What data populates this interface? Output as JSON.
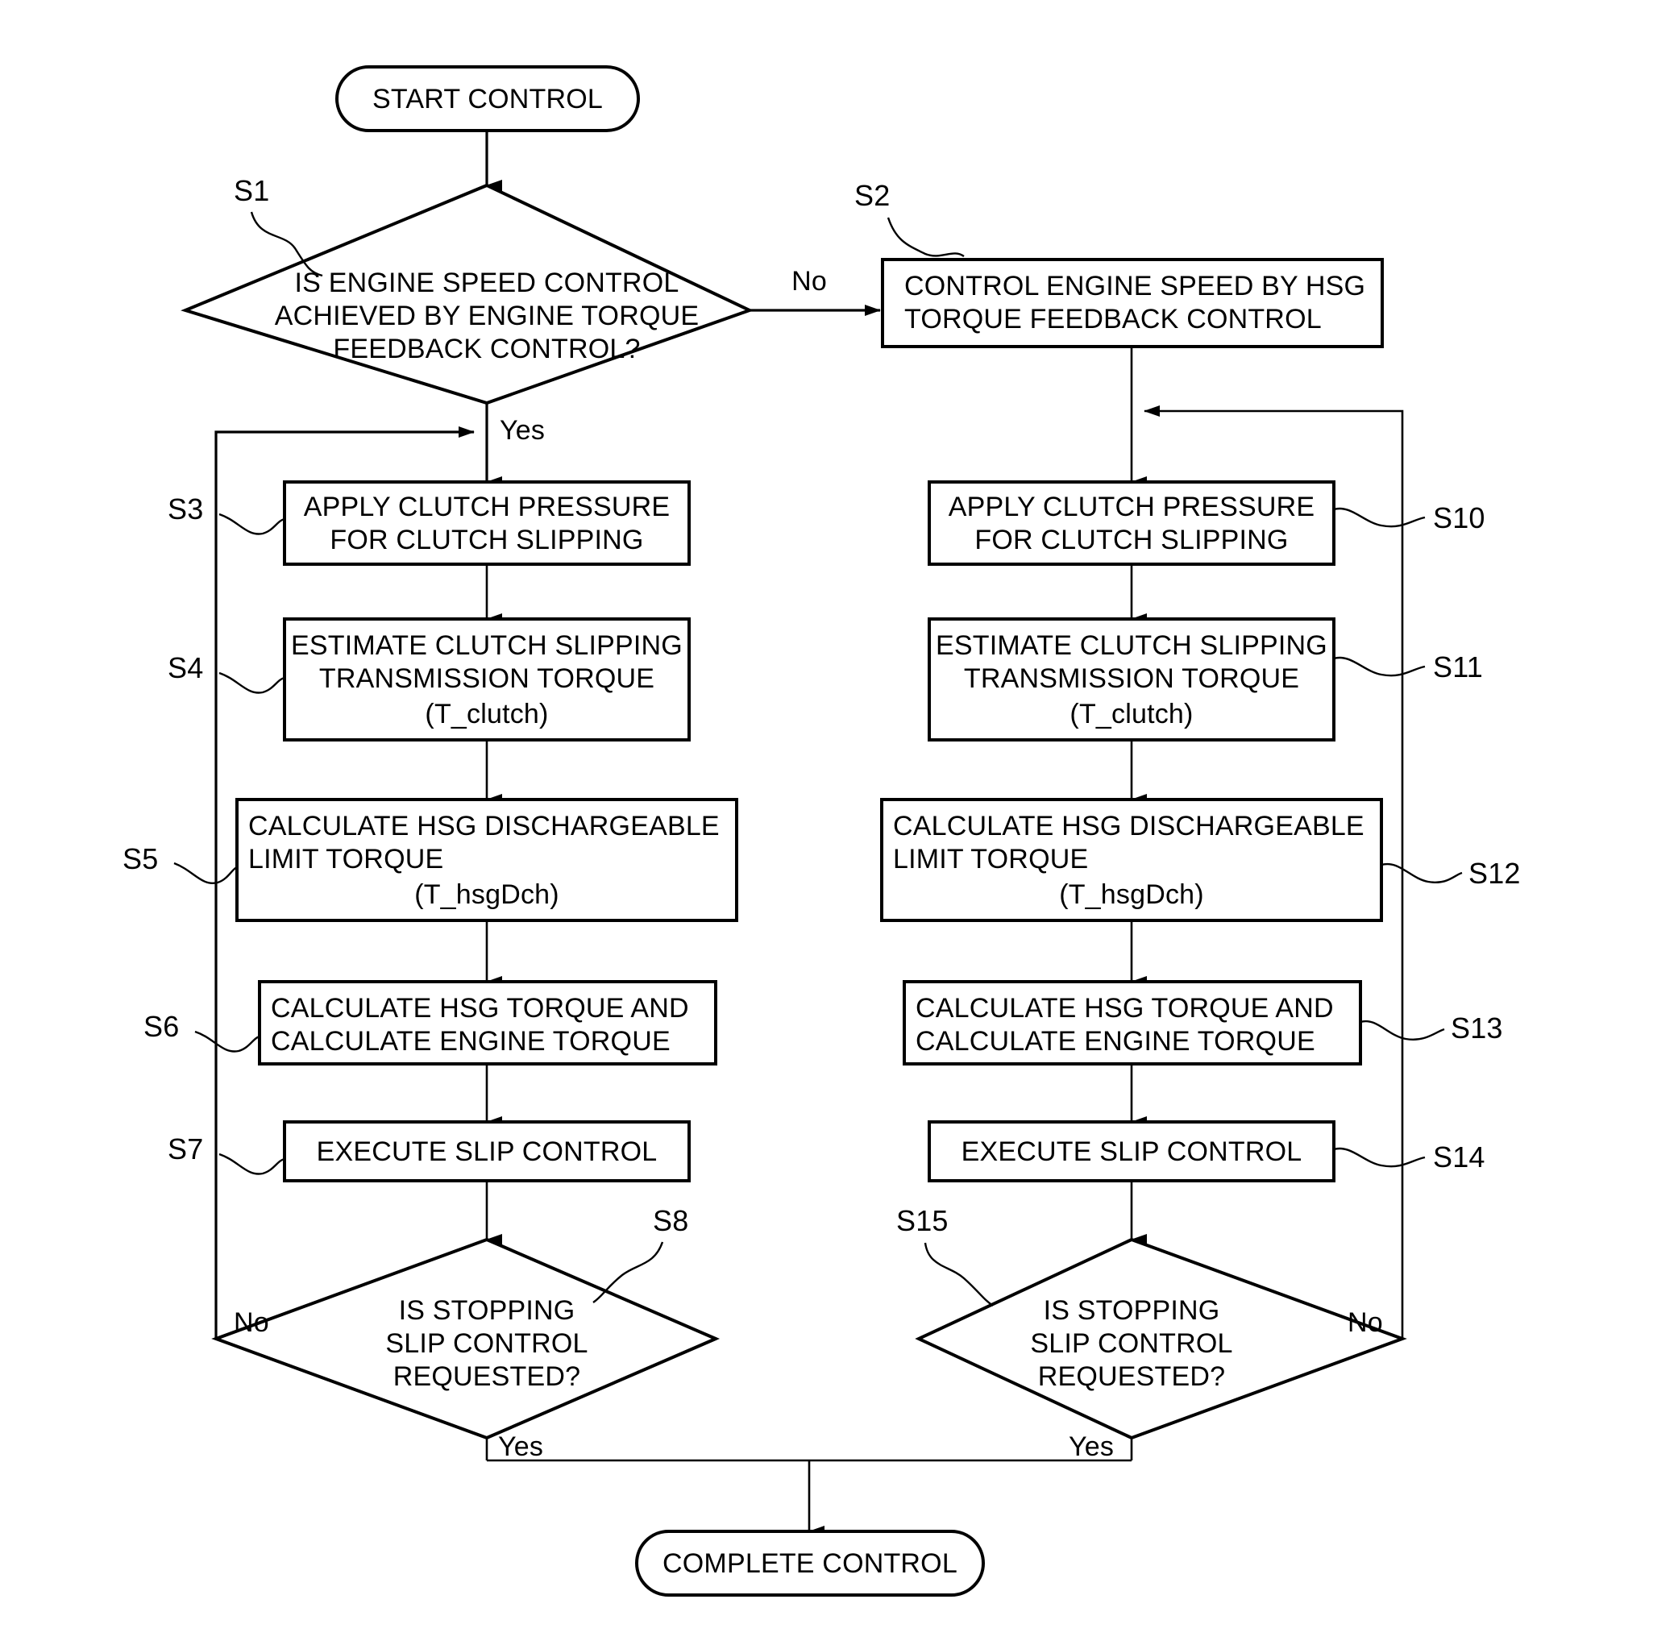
{
  "diagram": {
    "type": "flowchart",
    "title": "Engine speed and clutch slip control flowchart",
    "terminals": {
      "start": "START CONTROL",
      "end": "COMPLETE CONTROL"
    },
    "branch_labels": {
      "s1_no": "No",
      "s1_yes": "Yes",
      "s8_no": "No",
      "s8_yes": "Yes",
      "s15_no": "No",
      "s15_yes": "Yes"
    },
    "step_tags": {
      "s1": "S1",
      "s2": "S2",
      "s3": "S3",
      "s4": "S4",
      "s5": "S5",
      "s6": "S6",
      "s7": "S7",
      "s8": "S8",
      "s10": "S10",
      "s11": "S11",
      "s12": "S12",
      "s13": "S13",
      "s14": "S14",
      "s15": "S15"
    },
    "nodes": {
      "s1": {
        "kind": "decision",
        "lines": [
          "IS ENGINE SPEED CONTROL",
          "ACHIEVED BY ENGINE TORQUE",
          "FEEDBACK CONTROL?"
        ]
      },
      "s2": {
        "kind": "process",
        "lines": [
          "CONTROL ENGINE SPEED BY HSG",
          "TORQUE FEEDBACK CONTROL"
        ]
      },
      "s3": {
        "kind": "process",
        "lines": [
          "APPLY CLUTCH PRESSURE",
          "FOR CLUTCH SLIPPING"
        ]
      },
      "s4": {
        "kind": "process",
        "lines": [
          "ESTIMATE CLUTCH SLIPPING",
          "TRANSMISSION TORQUE",
          "(T_clutch)"
        ]
      },
      "s5": {
        "kind": "process",
        "lines": [
          "CALCULATE HSG DISCHARGEABLE",
          "LIMIT TORQUE",
          "(T_hsgDch)"
        ]
      },
      "s6": {
        "kind": "process",
        "lines": [
          "CALCULATE HSG TORQUE AND",
          "CALCULATE ENGINE TORQUE"
        ]
      },
      "s7": {
        "kind": "process",
        "lines": [
          "EXECUTE SLIP CONTROL"
        ]
      },
      "s8": {
        "kind": "decision",
        "lines": [
          "IS STOPPING",
          "SLIP CONTROL",
          "REQUESTED?"
        ]
      },
      "s10": {
        "kind": "process",
        "lines": [
          "APPLY CLUTCH PRESSURE",
          "FOR CLUTCH SLIPPING"
        ]
      },
      "s11": {
        "kind": "process",
        "lines": [
          "ESTIMATE CLUTCH SLIPPING",
          "TRANSMISSION TORQUE",
          "(T_clutch)"
        ]
      },
      "s12": {
        "kind": "process",
        "lines": [
          "CALCULATE HSG DISCHARGEABLE",
          "LIMIT TORQUE",
          "(T_hsgDch)"
        ]
      },
      "s13": {
        "kind": "process",
        "lines": [
          "CALCULATE HSG TORQUE AND",
          "CALCULATE ENGINE TORQUE"
        ]
      },
      "s14": {
        "kind": "process",
        "lines": [
          "EXECUTE SLIP CONTROL"
        ]
      },
      "s15": {
        "kind": "decision",
        "lines": [
          "IS STOPPING",
          "SLIP CONTROL",
          "REQUESTED?"
        ]
      }
    },
    "colors": {
      "stroke": "#000000",
      "fill": "#ffffff",
      "text": "#000000"
    }
  }
}
